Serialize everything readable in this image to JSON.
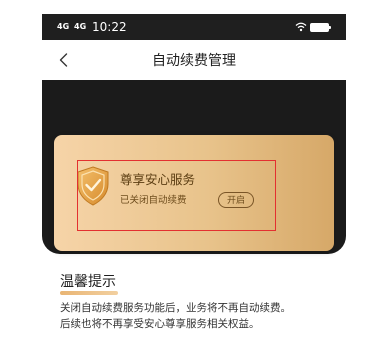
{
  "statusbar": {
    "signal_1": "4G",
    "signal_2": "4G",
    "time": "10:22",
    "wifi_icon": "wifi-icon",
    "battery_icon": "battery-icon"
  },
  "navbar": {
    "back_icon": "chevron-left-icon",
    "title": "自动续费管理"
  },
  "card": {
    "icon": "shield-check-icon",
    "title": "尊享安心服务",
    "status": "已关闭自动续费",
    "toggle_label": "开启",
    "colors": {
      "gradient_start": "#f6d4a8",
      "gradient_end": "#d6a868",
      "highlight_border": "#e33030"
    }
  },
  "tips": {
    "title": "温馨提示",
    "lines": [
      "关闭自动续费服务功能后，业务将不再自动续费。",
      "后续也将不再享受安心尊享服务相关权益。"
    ]
  }
}
